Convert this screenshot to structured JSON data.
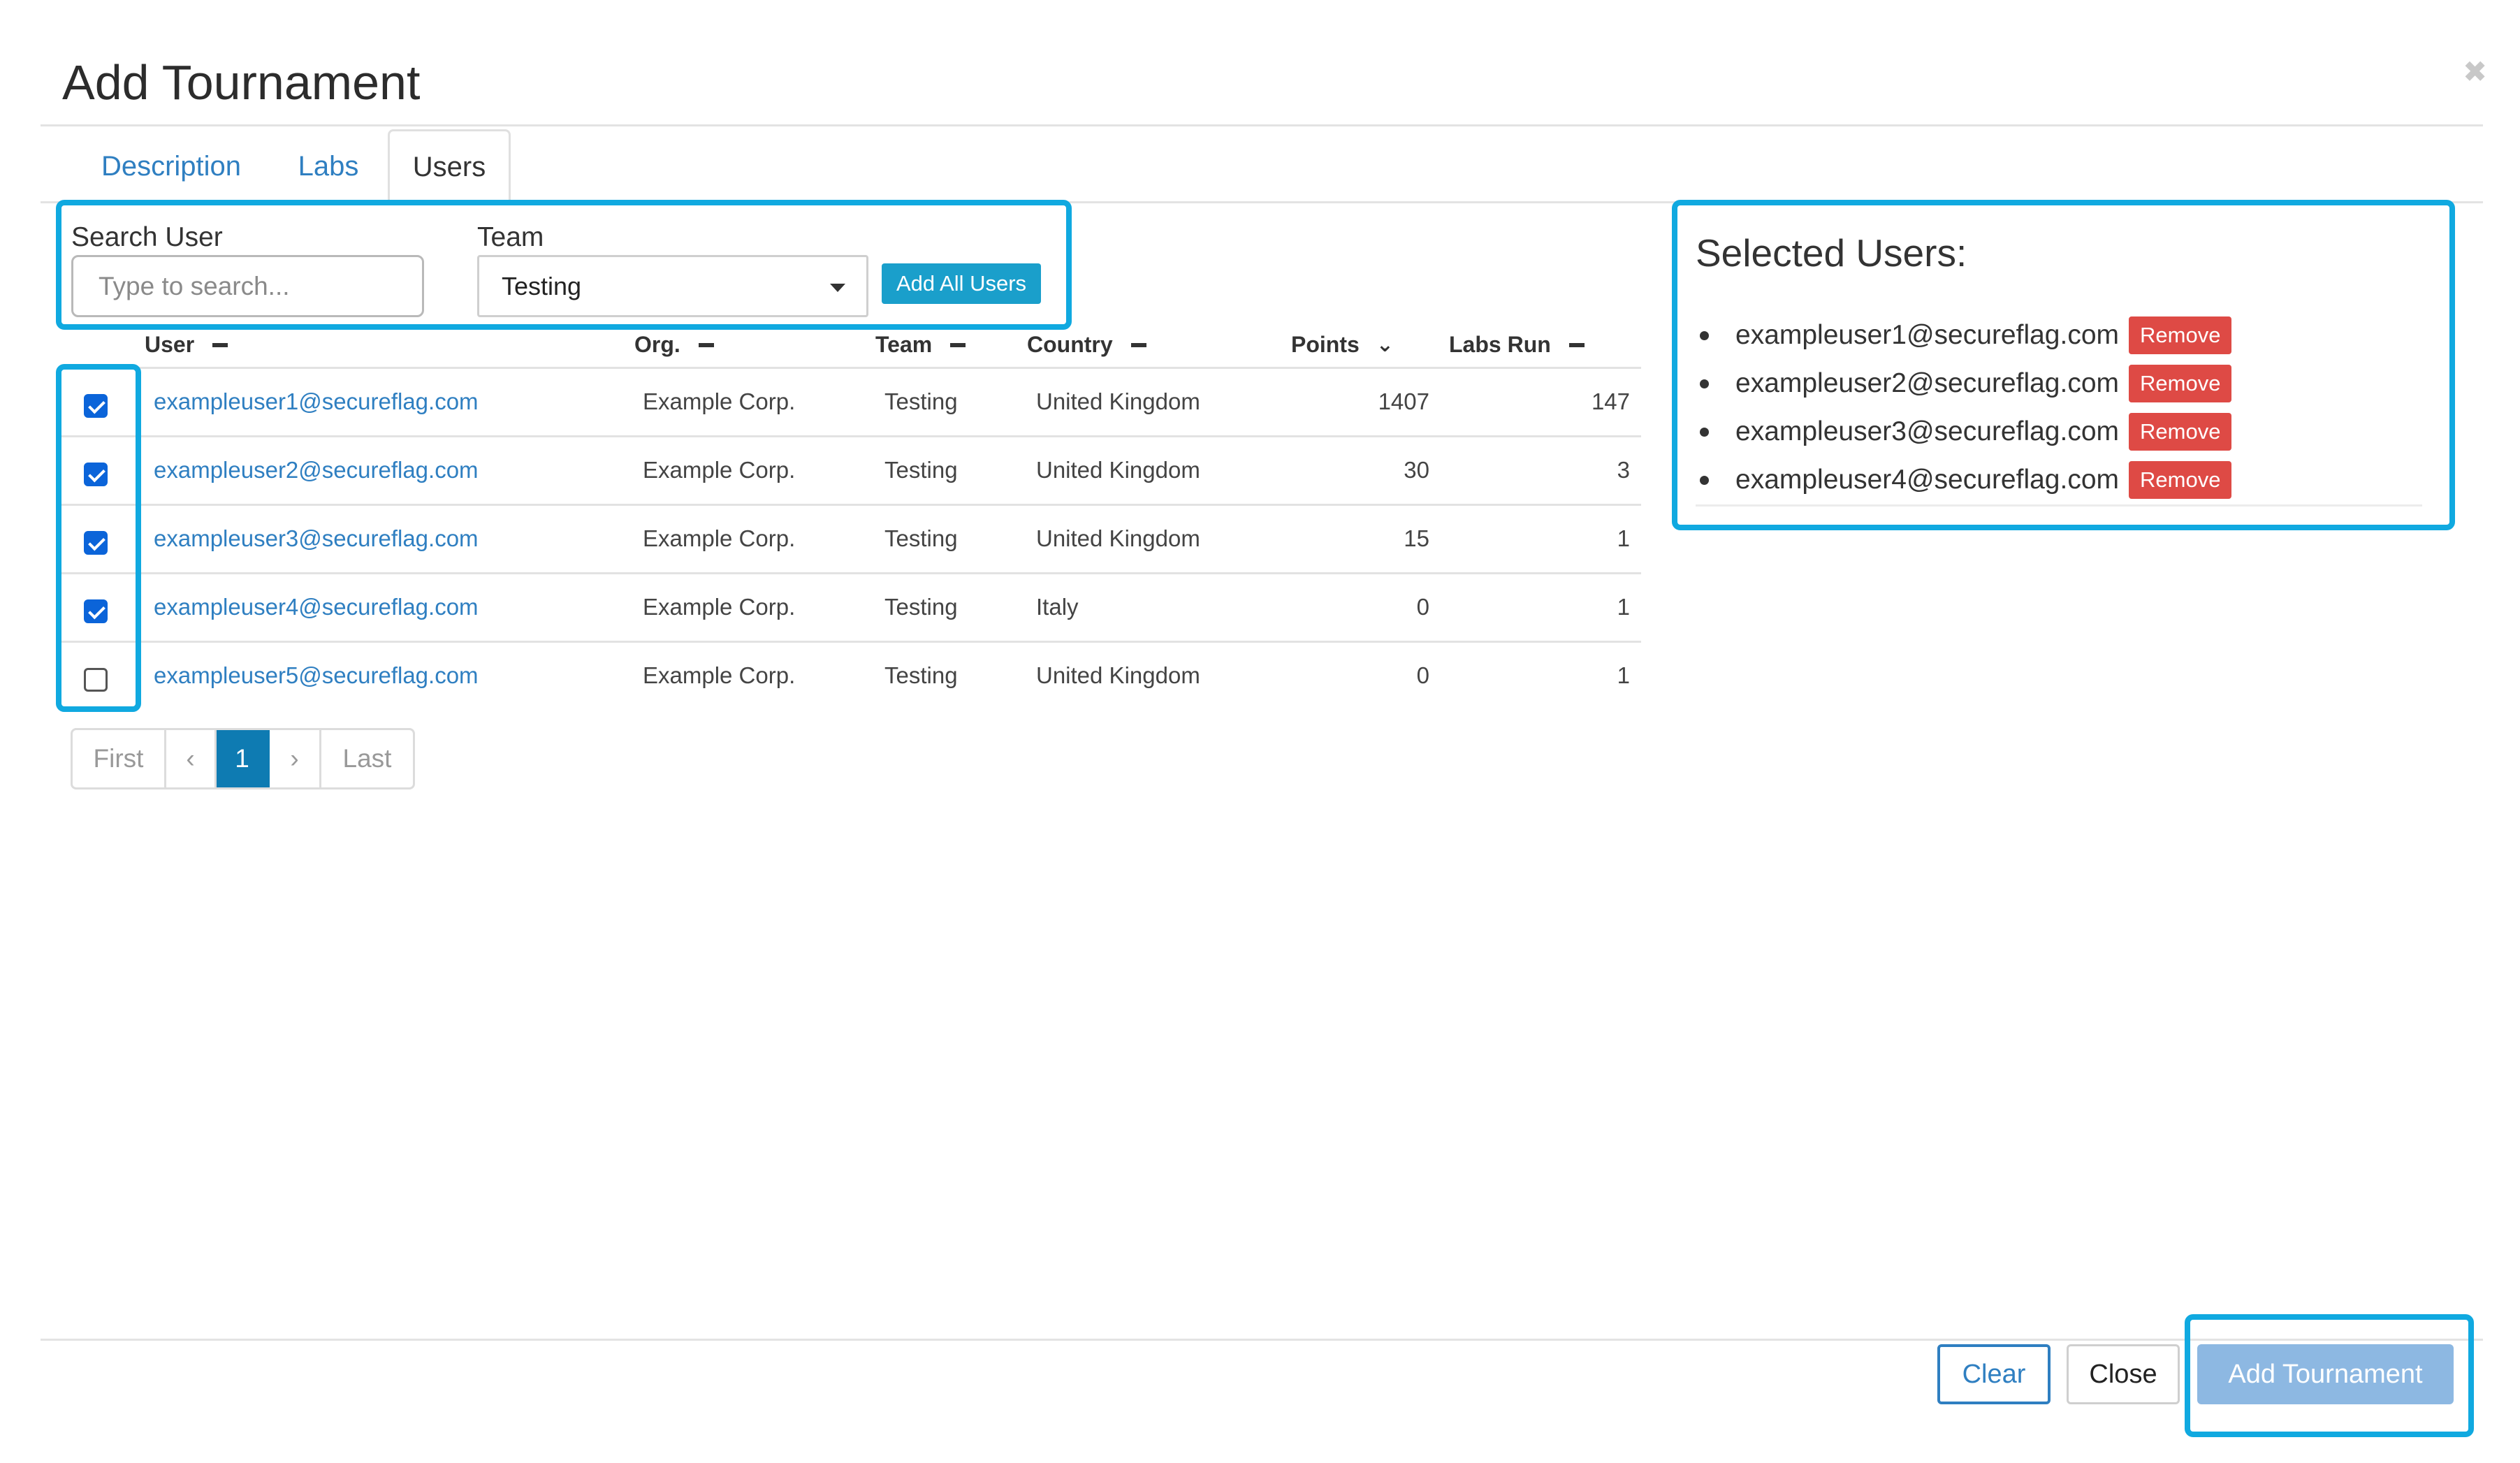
{
  "modal": {
    "title": "Add Tournament",
    "close_icon": "close-icon"
  },
  "tabs": [
    {
      "label": "Description",
      "active": false
    },
    {
      "label": "Labs",
      "active": false
    },
    {
      "label": "Users",
      "active": true
    }
  ],
  "filters": {
    "search_label": "Search User",
    "search_placeholder": "Type to search...",
    "search_value": "",
    "team_label": "Team",
    "team_value": "Testing",
    "add_all_label": "Add All Users"
  },
  "table": {
    "columns": [
      {
        "label": "User",
        "sort": "none"
      },
      {
        "label": "Org.",
        "sort": "none"
      },
      {
        "label": "Team",
        "sort": "none"
      },
      {
        "label": "Country",
        "sort": "none"
      },
      {
        "label": "Points",
        "sort": "desc"
      },
      {
        "label": "Labs Run",
        "sort": "none"
      }
    ],
    "rows": [
      {
        "checked": true,
        "user": "exampleuser1@secureflag.com",
        "org": "Example Corp.",
        "team": "Testing",
        "country": "United Kingdom",
        "points": "1407",
        "labs_run": "147"
      },
      {
        "checked": true,
        "user": "exampleuser2@secureflag.com",
        "org": "Example Corp.",
        "team": "Testing",
        "country": "United Kingdom",
        "points": "30",
        "labs_run": "3"
      },
      {
        "checked": true,
        "user": "exampleuser3@secureflag.com",
        "org": "Example Corp.",
        "team": "Testing",
        "country": "United Kingdom",
        "points": "15",
        "labs_run": "1"
      },
      {
        "checked": true,
        "user": "exampleuser4@secureflag.com",
        "org": "Example Corp.",
        "team": "Testing",
        "country": "Italy",
        "points": "0",
        "labs_run": "1"
      },
      {
        "checked": false,
        "user": "exampleuser5@secureflag.com",
        "org": "Example Corp.",
        "team": "Testing",
        "country": "United Kingdom",
        "points": "0",
        "labs_run": "1"
      }
    ]
  },
  "pagination": {
    "first": "First",
    "prev": "‹",
    "current": "1",
    "next": "›",
    "last": "Last"
  },
  "selected": {
    "title": "Selected Users:",
    "remove_label": "Remove",
    "users": [
      "exampleuser1@secureflag.com",
      "exampleuser2@secureflag.com",
      "exampleuser3@secureflag.com",
      "exampleuser4@secureflag.com"
    ]
  },
  "footer": {
    "clear_label": "Clear",
    "close_label": "Close",
    "submit_label": "Add Tournament"
  },
  "colors": {
    "highlight": "#10a9e0",
    "link": "#2f7fc1",
    "remove": "#de4a45",
    "checkbox": "#0b64d9",
    "submit": "#8db8e2"
  }
}
